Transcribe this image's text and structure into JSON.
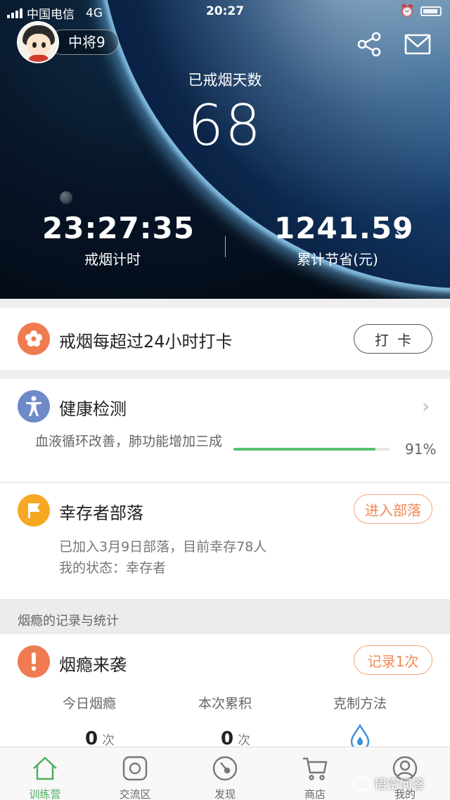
{
  "status_bar": {
    "carrier": "中国电信",
    "network": "4G",
    "time": "20:27"
  },
  "header": {
    "user_name": "中将9",
    "share_icon": "share-icon",
    "mail_icon": "mail-icon"
  },
  "hero": {
    "quit_days_label": "已戒烟天数",
    "quit_days_value": "68",
    "timer_value": "23:27:35",
    "timer_label": "戒烟计时",
    "saved_value": "1241.59",
    "saved_label": "累计节省(元)"
  },
  "checkin": {
    "title": "戒烟每超过24小时打卡",
    "button": "打卡"
  },
  "health": {
    "title": "健康检测",
    "description": "血液循环改善，肺功能增加三成",
    "progress": 0.91,
    "percent_label": "91%"
  },
  "tribe": {
    "title": "幸存者部落",
    "button": "进入部落",
    "line1": "已加入3月9日部落，目前幸存78人",
    "line2": "我的状态：幸存者"
  },
  "section_header": "烟瘾的记录与统计",
  "craving": {
    "title": "烟瘾来袭",
    "button": "记录1次",
    "columns": [
      {
        "label": "今日烟瘾",
        "value": "0",
        "unit": "次"
      },
      {
        "label": "本次累积",
        "value": "0",
        "unit": "次"
      },
      {
        "label": "克制方法"
      }
    ]
  },
  "tabs": [
    {
      "label": "训练营",
      "icon": "home-icon",
      "active": true
    },
    {
      "label": "交流区",
      "icon": "chat-icon",
      "active": false
    },
    {
      "label": "发现",
      "icon": "compass-icon",
      "active": false
    },
    {
      "label": "商店",
      "icon": "cart-icon",
      "active": false
    },
    {
      "label": "我的",
      "icon": "profile-icon",
      "active": false
    }
  ],
  "watermark": "悟空问答",
  "colors": {
    "accent_green": "#4cae5a",
    "orange": "#f07b50",
    "blue": "#6f8ac8",
    "yellow": "#f7a823"
  }
}
